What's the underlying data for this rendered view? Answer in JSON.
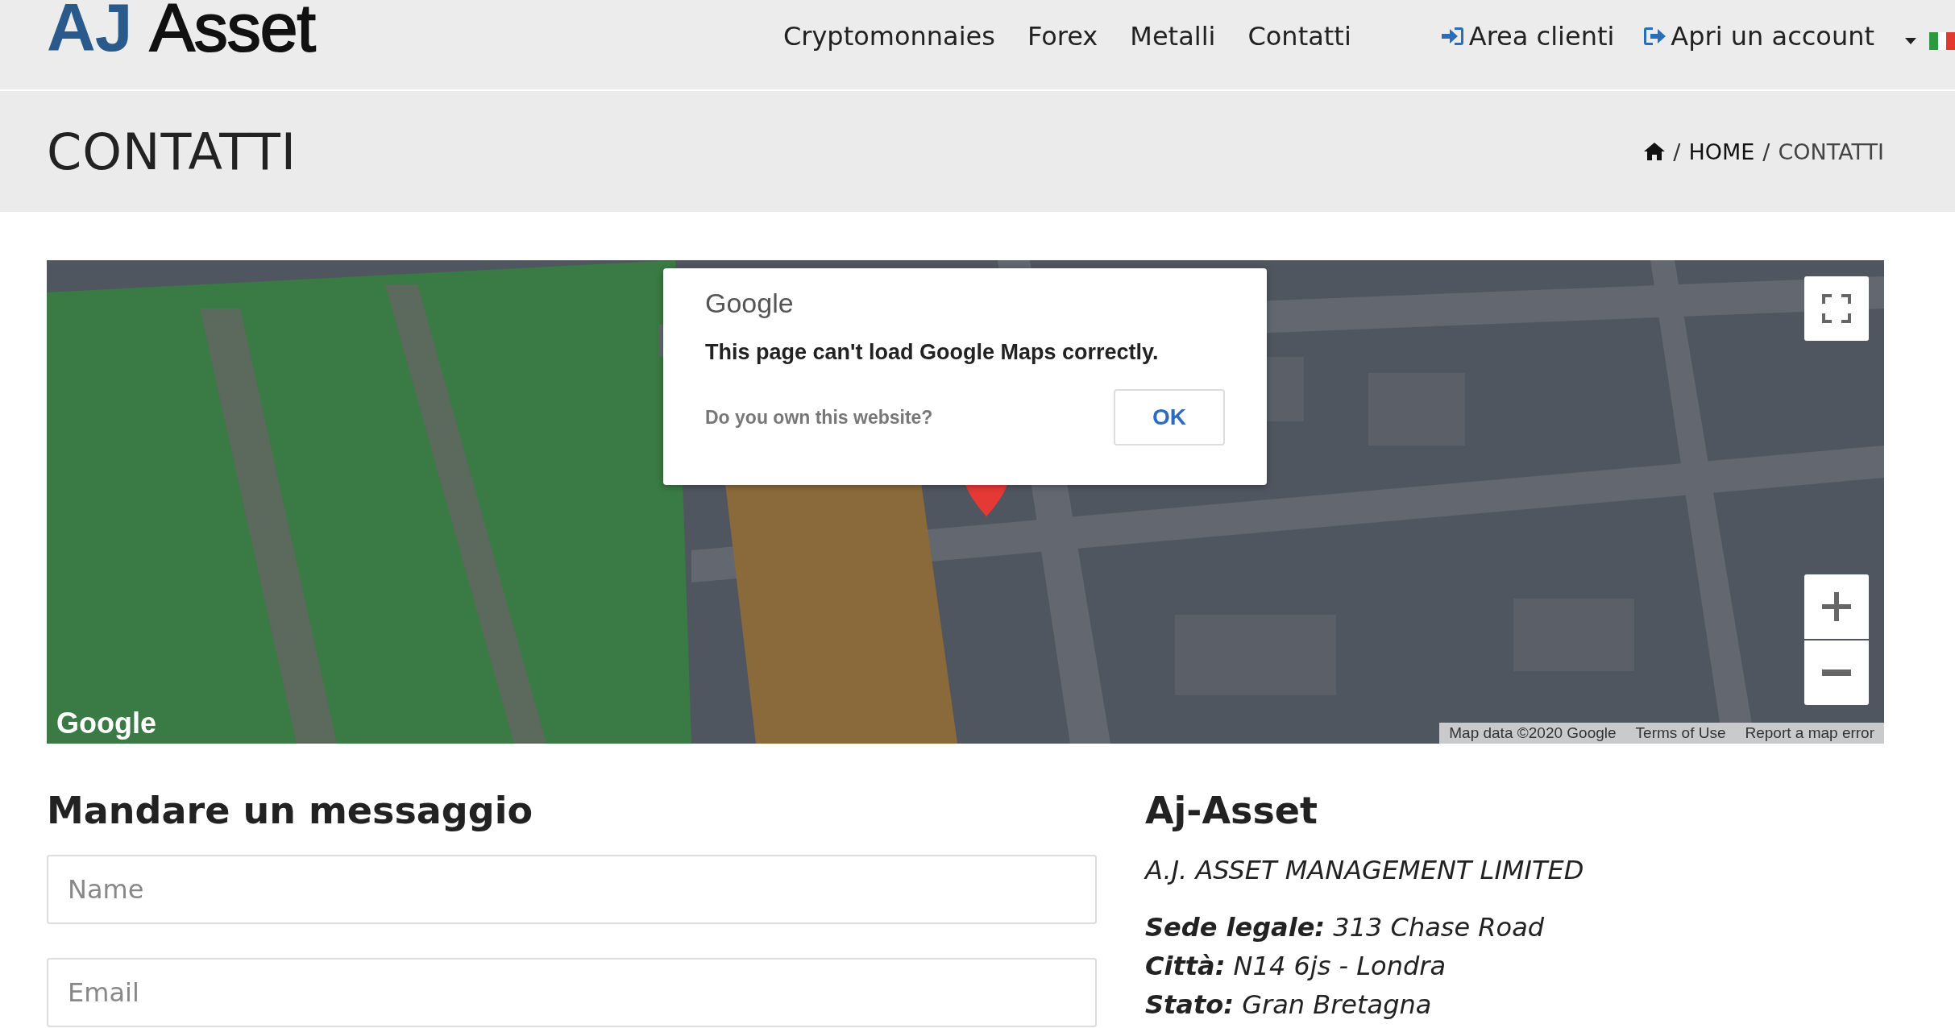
{
  "header": {
    "logo": {
      "accent": "AJ",
      "rest": "Asset"
    },
    "nav": [
      {
        "label": "Cryptomonnaies"
      },
      {
        "label": "Forex"
      },
      {
        "label": "Metalli"
      },
      {
        "label": "Contatti"
      }
    ],
    "account_links": [
      {
        "label": "Area clienti",
        "kind": "login"
      },
      {
        "label": "Apri un account",
        "kind": "signup"
      }
    ]
  },
  "title_bar": {
    "title": "CONTATTI",
    "breadcrumb_separator": "/",
    "breadcrumb": [
      {
        "label": "HOME"
      },
      {
        "label": "CONTATTI"
      }
    ]
  },
  "map": {
    "dialog": {
      "brand": "Google",
      "message": "This page can't load Google Maps correctly.",
      "question": "Do you own this website?",
      "button": "OK"
    },
    "logo": "Google",
    "attribution": [
      "Map data ©2020 Google",
      "Terms of Use",
      "Report a map error"
    ]
  },
  "contact_form": {
    "title": "Mandare un messaggio",
    "fields": [
      {
        "placeholder": "Name"
      },
      {
        "placeholder": "Email"
      }
    ]
  },
  "company": {
    "name": "Aj-Asset",
    "subtitle": "A.J. ASSET MANAGEMENT LIMITED",
    "details": [
      "**Sede legale:** 313 Chase Road",
      "**Città:** N14 6js - Londra",
      "**Stato:** Gran Bretagna"
    ]
  }
}
